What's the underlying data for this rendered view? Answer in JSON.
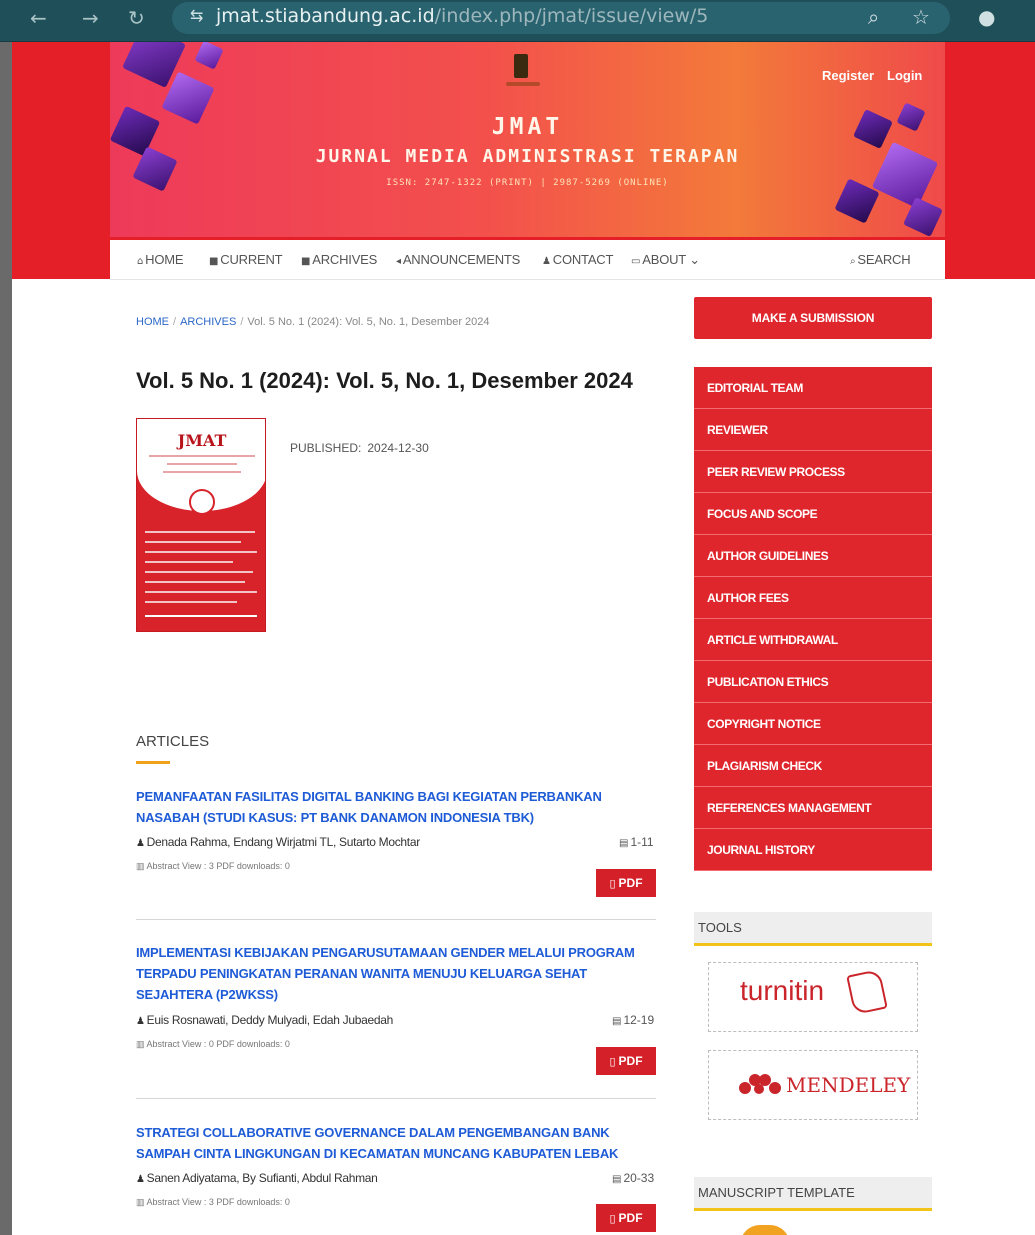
{
  "browser": {
    "url_host": "jmat.stiabandung.ac.id",
    "url_path": "/index.php/jmat/issue/view/5"
  },
  "header": {
    "journal_abbr": "JMAT",
    "journal_name": "JURNAL MEDIA ADMINISTRASI TERAPAN",
    "issn": "ISSN: 2747-1322 (PRINT) | 2987-5269 (ONLINE)",
    "register_label": "Register",
    "login_label": "Login"
  },
  "nav": {
    "home": "HOME",
    "current": "CURRENT",
    "archives": "ARCHIVES",
    "announcements": "ANNOUNCEMENTS",
    "contact": "CONTACT",
    "about": "ABOUT",
    "search": "SEARCH"
  },
  "breadcrumb": {
    "home": "HOME",
    "archives": "ARCHIVES",
    "current": "Vol. 5 No. 1 (2024): Vol. 5, No. 1, Desember 2024"
  },
  "issue": {
    "title": "Vol. 5 No. 1 (2024): Vol. 5, No. 1, Desember 2024",
    "cover_title": "JMAT",
    "published_label": "PUBLISHED:",
    "published_date": "2024-12-30"
  },
  "articles": {
    "heading": "ARTICLES",
    "pdf_label": "PDF",
    "items": [
      {
        "title": "PEMANFAATAN FASILITAS DIGITAL BANKING BAGI KEGIATAN PERBANKAN NASABAH (STUDI KASUS: PT BANK DANAMON INDONESIA TBK)",
        "authors": "Denada Rahma, Endang Wirjatmi TL, Sutarto Mochtar",
        "pages": "1-11",
        "stats": "Abstract View : 3  PDF downloads: 0"
      },
      {
        "title": "IMPLEMENTASI KEBIJAKAN PENGARUSUTAMAAN GENDER MELALUI PROGRAM TERPADU PENINGKATAN PERANAN WANITA MENUJU KELUARGA SEHAT SEJAHTERA (P2WKSS)",
        "authors": "Euis Rosnawati, Deddy Mulyadi, Edah Jubaedah",
        "pages": "12-19",
        "stats": "Abstract View : 0  PDF downloads: 0"
      },
      {
        "title": "STRATEGI COLLABORATIVE GOVERNANCE DALAM PENGEMBANGAN BANK SAMPAH CINTA LINGKUNGAN DI KECAMATAN MUNCANG KABUPATEN LEBAK",
        "authors": "Sanen Adiyatama, By Sufianti, Abdul Rahman",
        "pages": "20-33",
        "stats": "Abstract View : 3  PDF downloads: 0"
      }
    ]
  },
  "sidebar": {
    "submit_label": "MAKE A SUBMISSION",
    "menu": [
      "EDITORIAL TEAM",
      "REVIEWER",
      "PEER REVIEW PROCESS",
      "FOCUS AND SCOPE",
      "AUTHOR GUIDELINES",
      "AUTHOR FEES",
      "ARTICLE WITHDRAWAL",
      "PUBLICATION ETHICS",
      "COPYRIGHT NOTICE",
      "PLAGIARISM CHECK",
      "REFERENCES MANAGEMENT",
      "JOURNAL HISTORY"
    ],
    "tools_heading": "TOOLS",
    "turnitin_label": "turnitin",
    "mendeley_label": "MENDELEY",
    "template_heading": "MANUSCRIPT TEMPLATE"
  },
  "colors": {
    "brand_red": "#e0262d",
    "link_blue": "#1e5bd6",
    "accent_yellow": "#f2c318"
  }
}
